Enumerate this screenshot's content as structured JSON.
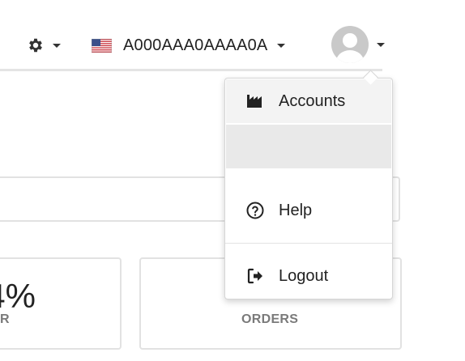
{
  "header": {
    "account_id": "A000AAA0AAAA0A"
  },
  "icons": {
    "settings": "gear-icon",
    "flag": "us-flag-icon",
    "avatar": "user-avatar-icon",
    "accounts": "factory-icon",
    "help": "question-circle-icon",
    "logout": "sign-out-icon"
  },
  "dropdown": {
    "items": [
      {
        "label": "Accounts"
      },
      {
        "label": ""
      },
      {
        "label": "Help"
      },
      {
        "label": "Logout"
      }
    ]
  },
  "cards": [
    {
      "value": "4%",
      "label": "R"
    },
    {
      "value": "",
      "label": "ORDERS"
    }
  ],
  "colors": {
    "menu_hover": "#f3f3f3",
    "menu_selected": "#e9e9e9",
    "border": "#e2e2e2",
    "muted_label": "#7a7a7a"
  }
}
